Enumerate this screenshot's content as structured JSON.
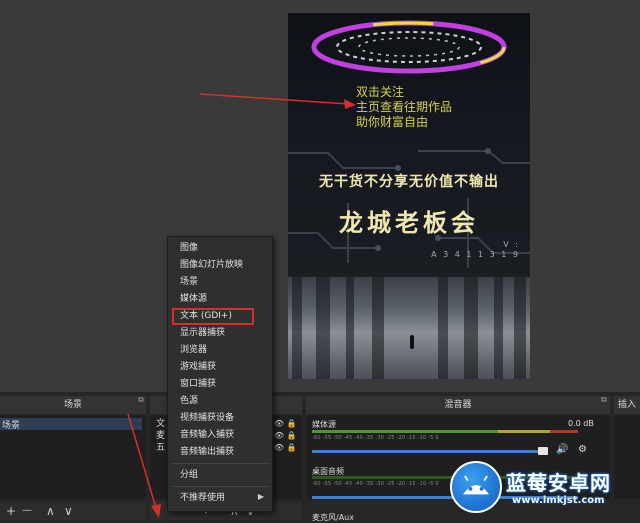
{
  "preview": {
    "overlay_lines": [
      "双击关注",
      "主页查看往期作品",
      "助你财富自由"
    ],
    "slogan": "无干货不分享无价值不输出",
    "brand": "龙城老板会",
    "code_line1": "V :",
    "code_line2": "A 3 4 1 1 3 1 9"
  },
  "context_menu": {
    "items": [
      "图像",
      "图像幻灯片放映",
      "场景",
      "媒体源",
      "文本 (GDI+)",
      "显示器捕获",
      "浏览器",
      "游戏捕获",
      "窗口捕获",
      "色源",
      "视频捕获设备",
      "音频输入捕获",
      "音频输出捕获"
    ],
    "group_label": "分组",
    "deprecated_label": "不推荐使用",
    "highlighted_index": 4
  },
  "docks": {
    "scenes_title": "场景",
    "scene_item": "场景",
    "sources_partial": [
      "文",
      "麦",
      "五"
    ],
    "mixer_title": "混音器",
    "transitions_partial": "插入",
    "toolbar_add": "+",
    "toolbar_remove": "—",
    "toolbar_up": "∧",
    "toolbar_down": "∨"
  },
  "mixer": {
    "channels": [
      {
        "name": "媒体源",
        "db": "0.0 dB",
        "ticks": "-60  -55  -50  -45  -40  -35  -30  -25  -20  -15  -10  -5  0"
      },
      {
        "name": "桌面音频",
        "db": "",
        "ticks": "-60  -55  -50  -45  -40  -35  -30  -25  -20  -15  -10  -5  0"
      },
      {
        "name": "麦克风/Aux",
        "db": "",
        "ticks": ""
      }
    ]
  },
  "watermark": {
    "title": "蓝莓安卓网",
    "url": "www.lmkjst.com"
  },
  "colors": {
    "highlight_border": "#d4302a",
    "meter_green": "#4c9a2a",
    "meter_yellow": "#b5a62a",
    "meter_red": "#b03a2a",
    "slider_blue": "#3f7fd0",
    "text_gold": "#d8d04a"
  }
}
